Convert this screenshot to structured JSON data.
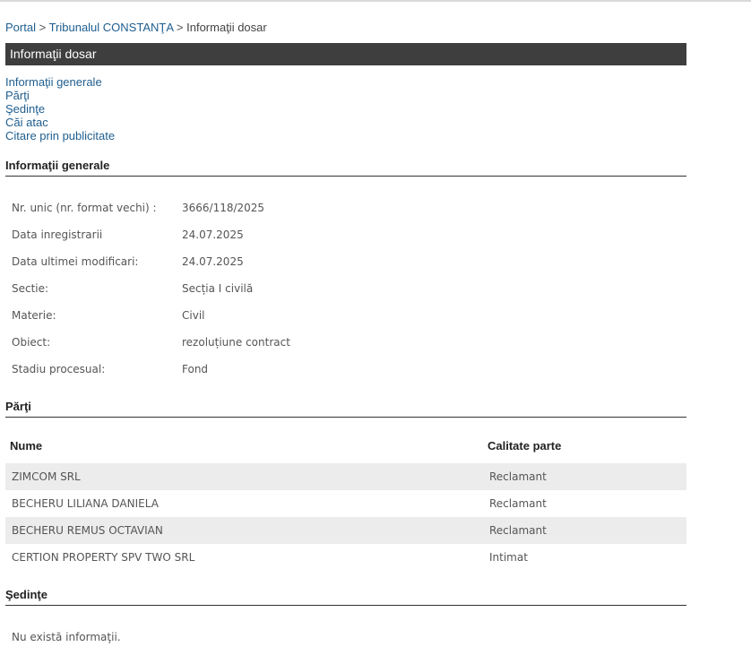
{
  "breadcrumb": {
    "portal": "Portal",
    "sep1": ">",
    "court": "Tribunalul CONSTANŢA",
    "sep2": ">",
    "current": "Informaţii dosar"
  },
  "title": "Informaţii dosar",
  "nav": [
    "Informaţii generale",
    "Părţi",
    "Şedinţe",
    "Căi atac",
    "Citare prin publicitate"
  ],
  "general": {
    "heading": "Informaţii generale",
    "rows": [
      {
        "label": "Nr. unic (nr. format vechi) :",
        "value": "3666/118/2025"
      },
      {
        "label": "Data inregistrarii",
        "value": "24.07.2025"
      },
      {
        "label": "Data ultimei modificari:",
        "value": "24.07.2025"
      },
      {
        "label": "Sectie:",
        "value": "Secția I civilă"
      },
      {
        "label": "Materie:",
        "value": "Civil"
      },
      {
        "label": "Obiect:",
        "value": "rezoluțiune contract"
      },
      {
        "label": "Stadiu procesual:",
        "value": "Fond"
      }
    ]
  },
  "parties": {
    "heading": "Părţi",
    "col_name": "Nume",
    "col_role": "Calitate parte",
    "rows": [
      {
        "name": "ZIMCOM SRL",
        "role": "Reclamant"
      },
      {
        "name": "BECHERU LILIANA DANIELA",
        "role": "Reclamant"
      },
      {
        "name": "BECHERU REMUS OCTAVIAN",
        "role": "Reclamant"
      },
      {
        "name": "CERTION PROPERTY SPV TWO SRL",
        "role": "Intimat"
      }
    ]
  },
  "hearings": {
    "heading": "Şedinţe",
    "empty": "Nu există informaţii."
  }
}
